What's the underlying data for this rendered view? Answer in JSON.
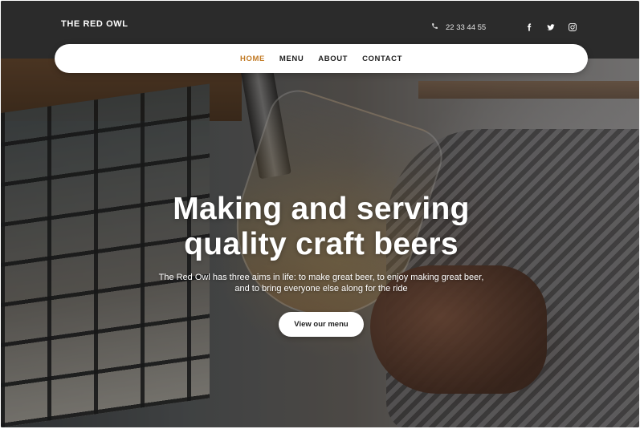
{
  "header": {
    "brand": "THE RED OWL",
    "phone": "22 33 44 55",
    "social_icons": [
      "facebook-icon",
      "twitter-icon",
      "instagram-icon"
    ]
  },
  "nav": {
    "items": [
      {
        "label": "HOME",
        "active": true
      },
      {
        "label": "MENU",
        "active": false
      },
      {
        "label": "ABOUT",
        "active": false
      },
      {
        "label": "CONTACT",
        "active": false
      }
    ]
  },
  "hero": {
    "headline_line1": "Making and serving",
    "headline_line2": "quality craft beers",
    "subtext": "The Red Owl has three aims in life: to make great beer, to enjoy making great beer, and to bring everyone else along for the ride",
    "cta_label": "View our menu"
  },
  "colors": {
    "accent": "#c27a24",
    "topbar": "#2b2b2b",
    "nav_background": "#ffffff",
    "text_light": "#ffffff"
  }
}
